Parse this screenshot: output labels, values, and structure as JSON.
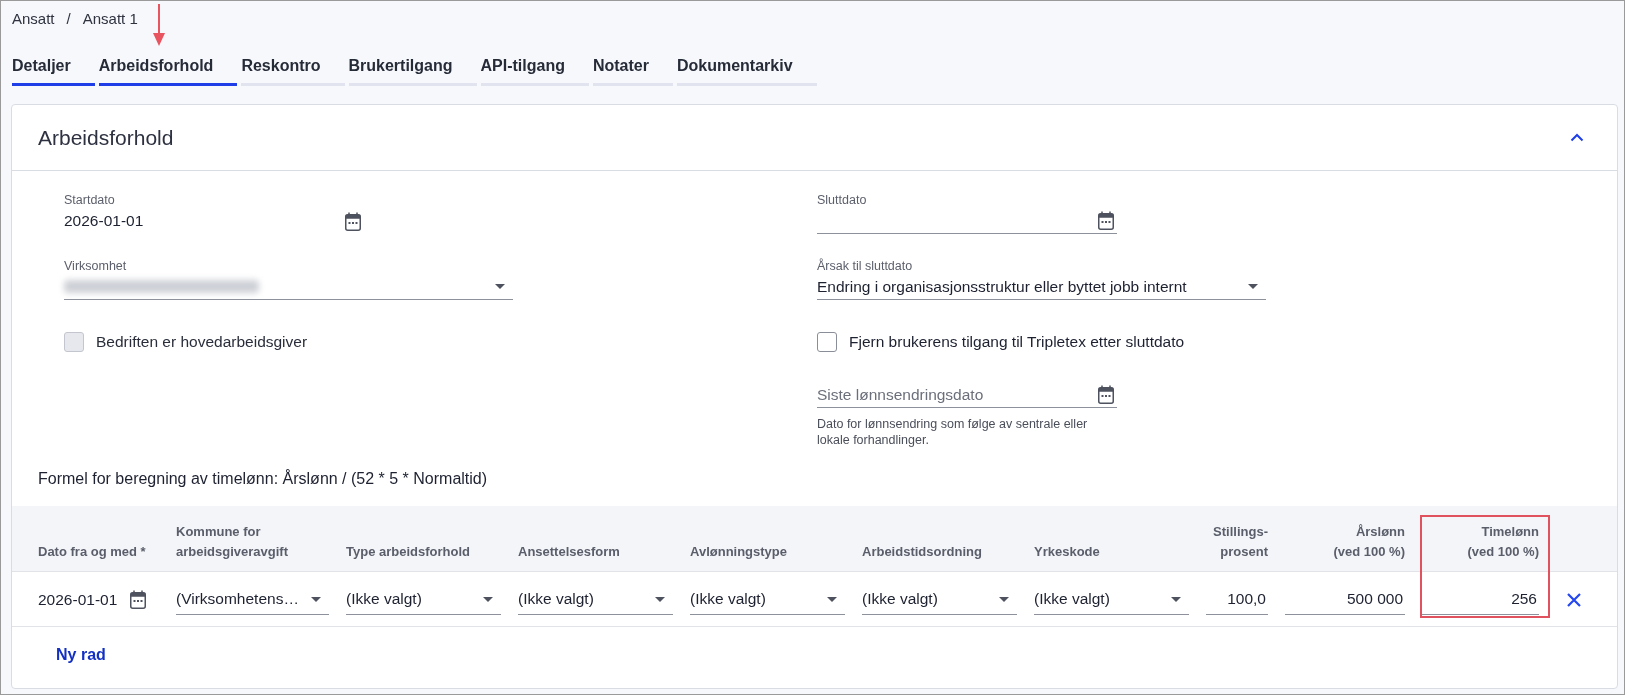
{
  "breadcrumb": {
    "items": [
      "Ansatt",
      "Ansatt 1"
    ],
    "separator": "/"
  },
  "tabs": [
    {
      "label": "Detaljer",
      "selected": true,
      "annotated": false
    },
    {
      "label": "Arbeidsforhold",
      "selected": true,
      "annotated": true
    },
    {
      "label": "Reskontro",
      "selected": false,
      "annotated": false
    },
    {
      "label": "Brukertilgang",
      "selected": false,
      "annotated": false
    },
    {
      "label": "API-tilgang",
      "selected": false,
      "annotated": false
    },
    {
      "label": "Notater",
      "selected": false,
      "annotated": false
    },
    {
      "label": "Dokumentarkiv",
      "selected": false,
      "annotated": false
    }
  ],
  "panel": {
    "title": "Arbeidsforhold",
    "expanded": true,
    "form": {
      "left": [
        {
          "kind": "date",
          "label": "Startdato",
          "value": "2026-01-01",
          "readonly": true
        },
        {
          "kind": "select",
          "label": "Virksomhet",
          "redacted": true
        },
        {
          "kind": "checkbox",
          "label": "Bedriften er hovedarbeidsgiver",
          "checked": false,
          "disabled": true
        }
      ],
      "right": [
        {
          "kind": "date",
          "label": "Sluttdato",
          "readonly": false
        },
        {
          "kind": "select",
          "label": "Årsak til sluttdato",
          "value": "Endring i organisasjonsstruktur eller byttet jobb internt"
        },
        {
          "kind": "checkbox",
          "label": "Fjern brukerens tilgang til Tripletex etter sluttdato",
          "checked": false,
          "disabled": false
        },
        {
          "kind": "date",
          "placeholder": "Siste lønnsendringsdato",
          "help": "Dato for lønnsendring som følge av sentrale eller lokale forhandlinger.",
          "readonly": false
        }
      ]
    },
    "formula": "Formel for beregning av timelønn: Årslønn / (52 * 5 * Normaltid)",
    "table": {
      "columns": [
        {
          "label": "Dato fra og med *",
          "kind": "text",
          "highlighted": false
        },
        {
          "label": "Kommune for\narbeidsgiveravgift",
          "kind": "text",
          "highlighted": false
        },
        {
          "label": "Type arbeidsforhold",
          "kind": "text",
          "highlighted": false
        },
        {
          "label": "Ansettelsesform",
          "kind": "text",
          "highlighted": false
        },
        {
          "label": "Avlønningstype",
          "kind": "text",
          "highlighted": false
        },
        {
          "label": "Arbeidstidsordning",
          "kind": "text",
          "highlighted": false
        },
        {
          "label": "Yrkeskode",
          "kind": "text",
          "highlighted": false
        },
        {
          "label": "Stillings-\nprosent",
          "kind": "number",
          "highlighted": false
        },
        {
          "label": "Årslønn\n(ved 100 %)",
          "kind": "number",
          "highlighted": false
        },
        {
          "label": "Timelønn\n(ved 100 %)",
          "kind": "number",
          "highlighted": true
        }
      ],
      "rows": [
        {
          "cells": [
            {
              "kind": "date",
              "value": "2026-01-01"
            },
            {
              "kind": "select",
              "value": "(Virksomhetens…"
            },
            {
              "kind": "select",
              "value": "(Ikke valgt)"
            },
            {
              "kind": "select",
              "value": "(Ikke valgt)"
            },
            {
              "kind": "select",
              "value": "(Ikke valgt)"
            },
            {
              "kind": "select",
              "value": "(Ikke valgt)"
            },
            {
              "kind": "select",
              "value": "(Ikke valgt)"
            },
            {
              "kind": "number",
              "value": "100,0"
            },
            {
              "kind": "number",
              "value": "500 000"
            },
            {
              "kind": "number",
              "value": "256"
            }
          ]
        }
      ]
    },
    "add_row_button": "Ny rad"
  }
}
